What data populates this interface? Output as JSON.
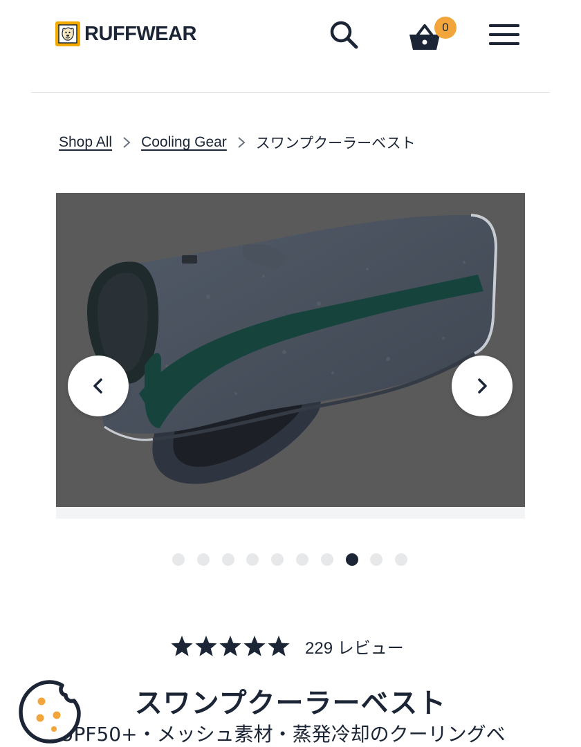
{
  "header": {
    "brand": "RUFFWEAR",
    "logo_icon": "dog-logo-icon",
    "search_icon": "search-icon",
    "cart_icon": "basket-icon",
    "cart_count": "0",
    "menu_icon": "hamburger-menu-icon"
  },
  "breadcrumb": {
    "items": [
      {
        "label": "Shop All"
      },
      {
        "label": "Cooling Gear"
      }
    ],
    "current": "スワンプクーラーベスト"
  },
  "gallery": {
    "prev_icon": "chevron-left-icon",
    "next_icon": "chevron-right-icon",
    "slide_count": 10,
    "active_slide": 8
  },
  "rating": {
    "stars": 5,
    "review_count": "229 レビュー"
  },
  "product": {
    "title": "スワンプクーラーベスト",
    "subtitle": "UPF50+・メッシュ素材・蒸発冷却のクーリングベ"
  },
  "cookie": {
    "icon": "cookie-icon"
  },
  "colors": {
    "navy": "#1b2535",
    "badge": "#f2a53a",
    "logo_yellow": "#f2a900",
    "gallery_bg": "#5b5a5b",
    "vest_body": "#48505c",
    "vest_stripe": "#17433d"
  }
}
